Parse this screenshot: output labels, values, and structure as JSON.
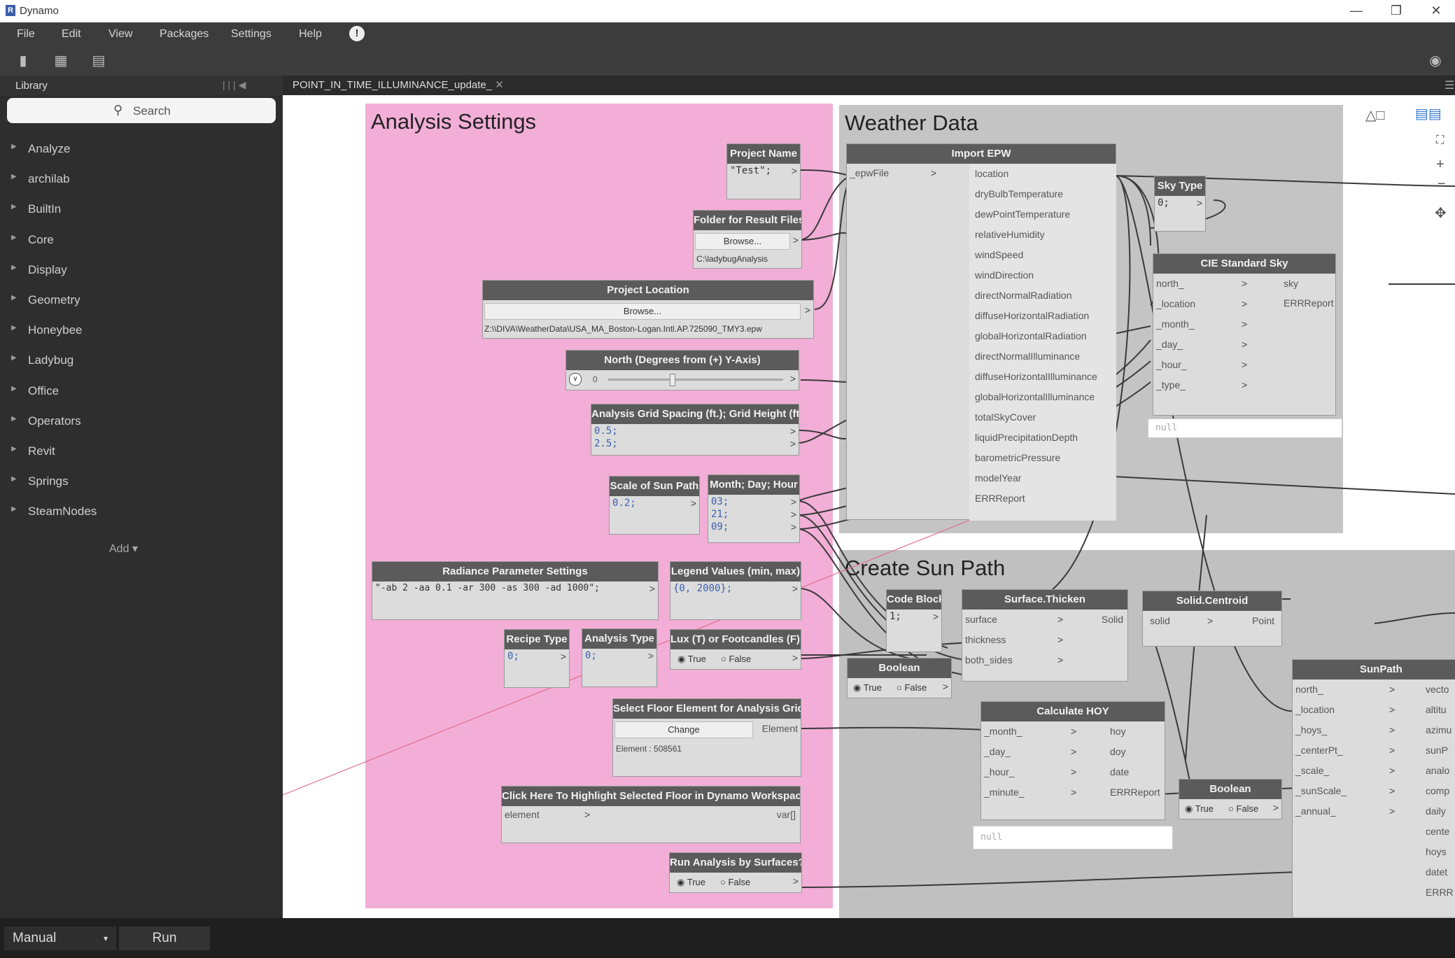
{
  "app": {
    "title": "Dynamo"
  },
  "menu": [
    "File",
    "Edit",
    "View",
    "Packages",
    "Settings",
    "Help"
  ],
  "library": {
    "header": "Library",
    "search_placeholder": "Search",
    "items": [
      "Analyze",
      "archilab",
      "BuiltIn",
      "Core",
      "Display",
      "Geometry",
      "Honeybee",
      "Ladybug",
      "Office",
      "Operators",
      "Revit",
      "Springs",
      "SteamNodes"
    ],
    "add_label": "Add"
  },
  "tab": {
    "label": "POINT_IN_TIME_ILLUMINANCE_update_"
  },
  "groups": {
    "analysis": "Analysis Settings",
    "weather": "Weather Data",
    "sunpath": "Create Sun Path"
  },
  "nodes": {
    "project_name": {
      "title": "Project Name",
      "value": "\"Test\";"
    },
    "folder": {
      "title": "Folder for Result Files",
      "button": "Browse...",
      "path": "C:\\ladybugAnalysis"
    },
    "project_location": {
      "title": "Project Location",
      "button": "Browse...",
      "path": "Z:\\\\DIVA\\WeatherData\\USA_MA_Boston-Logan.Intl.AP.725090_TMY3.epw"
    },
    "north": {
      "title": "North (Degrees from (+) Y-Axis)",
      "value": "0"
    },
    "grid": {
      "title": "Analysis Grid Spacing (ft.); Grid Height (ft.)",
      "line1": "0.5;",
      "line2": "2.5;"
    },
    "scale_sun": {
      "title": "Scale of Sun Path",
      "value": "0.2;"
    },
    "month_day_hour": {
      "title": "Month; Day; Hour",
      "line1": "03;",
      "line2": "21;",
      "line3": "09;"
    },
    "radiance": {
      "title": "Radiance Parameter Settings",
      "value": "\"-ab 2 -aa 0.1 -ar 300 -as 300 -ad 1000\";"
    },
    "legend": {
      "title": "Legend Values (min, max)",
      "value": "{0, 2000};"
    },
    "recipe": {
      "title": "Recipe Type",
      "value": "0;"
    },
    "analysis_type": {
      "title": "Analysis Type",
      "value": "0;"
    },
    "lux": {
      "title": "Lux (T) or Footcandles (F)?",
      "true_label": "True",
      "false_label": "False"
    },
    "floor": {
      "title": "Select Floor Element for Analysis Grid",
      "button": "Change",
      "port": "Element",
      "info": "Element : 508561"
    },
    "highlight": {
      "title": "Click Here To Highlight Selected Floor in Dynamo Workspace",
      "in": "element",
      "out": "var[]"
    },
    "run_surfaces": {
      "title": "Run Analysis by Surfaces?",
      "true_label": "True",
      "false_label": "False"
    },
    "import_epw": {
      "title": "Import EPW",
      "input": "_epwFile",
      "outputs": [
        "location",
        "dryBulbTemperature",
        "dewPointTemperature",
        "relativeHumidity",
        "windSpeed",
        "windDirection",
        "directNormalRadiation",
        "diffuseHorizontalRadiation",
        "globalHorizontalRadiation",
        "directNormalIlluminance",
        "diffuseHorizontalIlluminance",
        "globalHorizontalIlluminance",
        "totalSkyCover",
        "liquidPrecipitationDepth",
        "barometricPressure",
        "modelYear",
        "ERRReport"
      ]
    },
    "sky_type": {
      "title": "Sky Type",
      "value": "0;"
    },
    "cie_sky": {
      "title": "CIE Standard Sky",
      "inputs": [
        "north_",
        "_location",
        "_month_",
        "_day_",
        "_hour_",
        "_type_"
      ],
      "outputs": [
        "sky",
        "ERRReport"
      ],
      "null": "null"
    },
    "code_block": {
      "title": "Code Block",
      "value": "1;"
    },
    "surface_thicken": {
      "title": "Surface.Thicken",
      "inputs": [
        "surface",
        "thickness",
        "both_sides"
      ],
      "output": "Solid"
    },
    "solid_centroid": {
      "title": "Solid.Centroid",
      "input": "solid",
      "output": "Point"
    },
    "boolean1": {
      "title": "Boolean",
      "true_label": "True",
      "false_label": "False"
    },
    "calc_hoy": {
      "title": "Calculate HOY",
      "inputs": [
        "_month_",
        "_day_",
        "_hour_",
        "_minute_"
      ],
      "outputs": [
        "hoy",
        "doy",
        "date",
        "ERRReport"
      ],
      "null": "null"
    },
    "boolean2": {
      "title": "Boolean",
      "true_label": "True",
      "false_label": "False"
    },
    "sunpath": {
      "title": "SunPath",
      "inputs": [
        "north_",
        "_location",
        "_hoys_",
        "_centerPt_",
        "_scale_",
        "_sunScale_",
        "_annual_"
      ],
      "outputs": [
        "vecto",
        "altitu",
        "azimu",
        "sunP",
        "analo",
        "comp",
        "daily",
        "cente",
        "hoys",
        "datet",
        "ERRR"
      ]
    }
  },
  "bottom": {
    "run_mode": "Manual",
    "run_label": "Run"
  },
  "colors": {
    "analysis_group": "#f2aed6",
    "weather_group": "#c4c4c4",
    "node_header": "#5b5b5b"
  }
}
